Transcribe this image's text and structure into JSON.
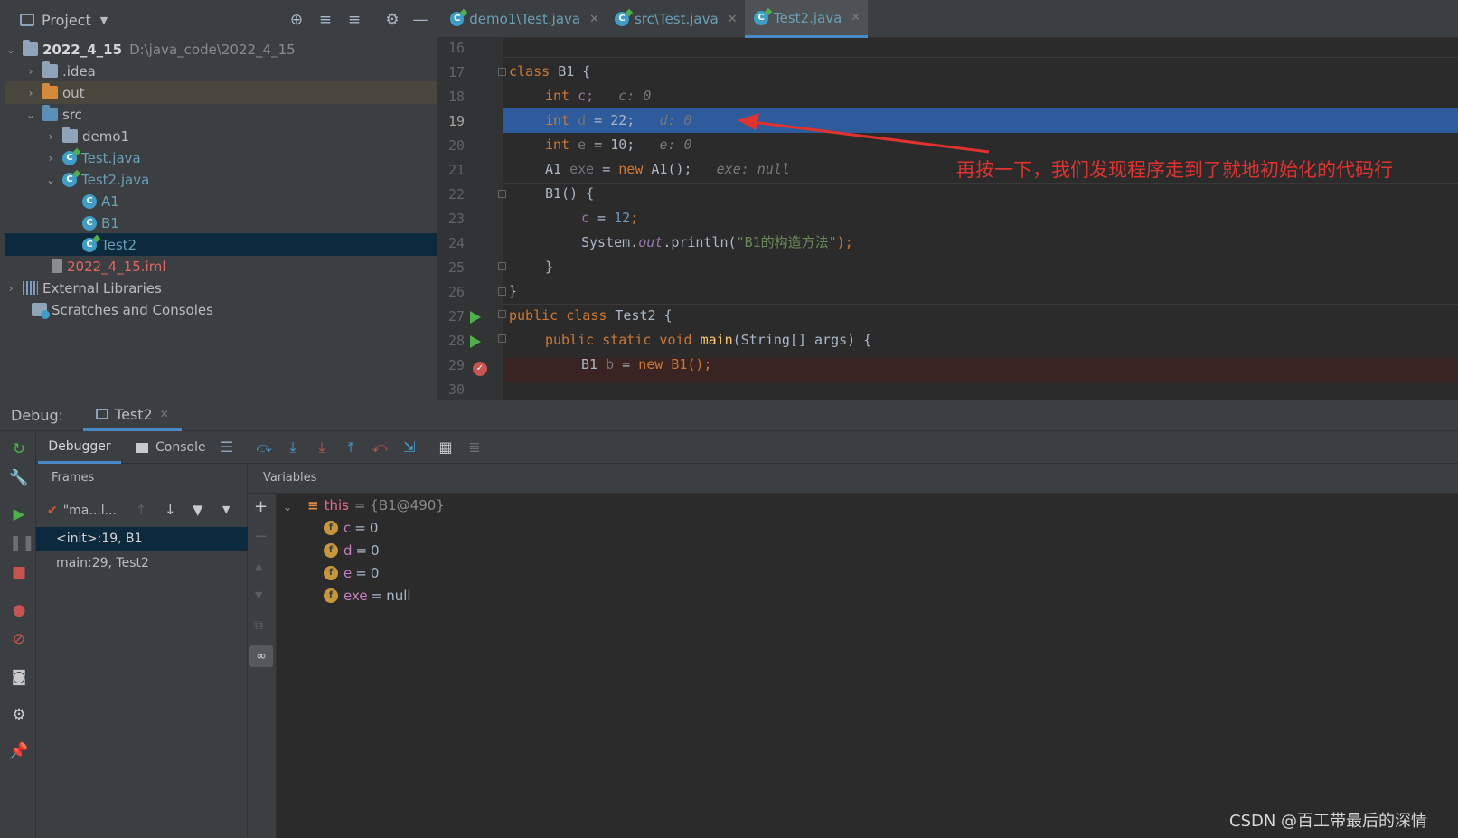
{
  "project": {
    "title": "Project",
    "tree": [
      {
        "label": "2022_4_15",
        "path": "D:\\java_code\\2022_4_15"
      },
      {
        "label": ".idea"
      },
      {
        "label": "out"
      },
      {
        "label": "src"
      },
      {
        "label": "demo1"
      },
      {
        "label": "Test.java"
      },
      {
        "label": "Test2.java"
      },
      {
        "label": "A1"
      },
      {
        "label": "B1"
      },
      {
        "label": "Test2"
      },
      {
        "label": "2022_4_15.iml"
      },
      {
        "label": "External Libraries"
      },
      {
        "label": "Scratches and Consoles"
      }
    ]
  },
  "editor": {
    "tabs": [
      {
        "label": "demo1\\Test.java"
      },
      {
        "label": "src\\Test.java"
      },
      {
        "label": "Test2.java"
      }
    ],
    "line_numbers": [
      "16",
      "17",
      "18",
      "19",
      "20",
      "21",
      "22",
      "23",
      "24",
      "25",
      "26",
      "27",
      "28",
      "29",
      "30"
    ],
    "lines": {
      "l17": {
        "kw": "class",
        "name": "B1 {"
      },
      "l18": {
        "type": "int",
        "var": "c;",
        "hint": "c: 0"
      },
      "l19": {
        "type": "int",
        "var": "d",
        "rest": " = 22;",
        "hint": "d: 0"
      },
      "l20": {
        "type": "int",
        "var": "e",
        "rest": " = 10;",
        "hint": "e: 0"
      },
      "l21": {
        "type": "A1",
        "var": "exe",
        "eq": " = ",
        "kw": "new",
        "rest": " A1();",
        "hint": "exe: null"
      },
      "l22": {
        "text": "B1() {"
      },
      "l23": {
        "var": "c",
        "rest": " = ",
        "num": "12",
        "end": ";"
      },
      "l24": {
        "obj": "System.",
        "field": "out",
        "call": ".println(",
        "str": "\"B1的构造方法\"",
        "end": ");"
      },
      "l25": {
        "text": "}"
      },
      "l26": {
        "text": "}"
      },
      "l27": {
        "kw": "public class",
        "name": " Test2 {"
      },
      "l28": {
        "kw": "public static void",
        "fn": " main",
        "rest": "(String[] args) {"
      },
      "l29": {
        "type": "B1",
        "var": " b",
        "eq": " = ",
        "kw": "new",
        "rest": " B1();"
      }
    }
  },
  "annotation": "再按一下，我们发现程序走到了就地初始化的代码行",
  "debug": {
    "label": "Debug:",
    "session_tab": "Test2",
    "tabs": {
      "debugger": "Debugger",
      "console": "Console"
    },
    "frames_title": "Frames",
    "variables_title": "Variables",
    "thread": "\"ma...l...",
    "frames": [
      "<init>:19, B1",
      "main:29, Test2"
    ],
    "this_row": {
      "name": "this",
      "value": "= {B1@490}"
    },
    "fields": [
      {
        "name": "c",
        "value": "0"
      },
      {
        "name": "d",
        "value": "0"
      },
      {
        "name": "e",
        "value": "0"
      },
      {
        "name": "exe",
        "value": "null"
      }
    ]
  },
  "watermark": "CSDN @百工带最后的深情",
  "colors": {
    "exec_line": "#2d5b9b",
    "breakpoint_line": "#3a2323",
    "accent": "#4a88c7",
    "annotation": "#e0322f"
  }
}
